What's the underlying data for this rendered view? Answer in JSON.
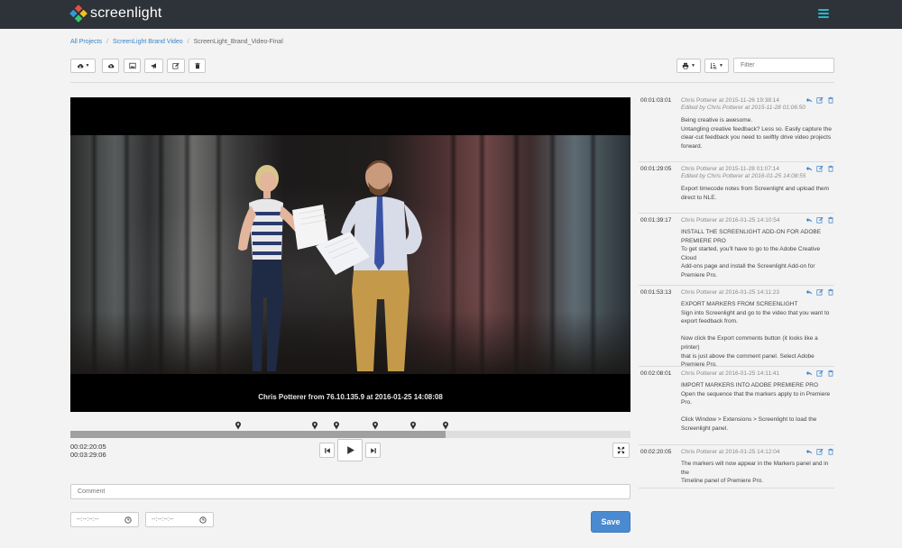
{
  "header": {
    "app_name": "screenlight",
    "logo_icon": "screenlight-logo-icon",
    "menu_icon": "hamburger-menu-icon",
    "accent_color": "#29b6c8"
  },
  "breadcrumb": {
    "items": [
      "All Projects",
      "ScreenLight Brand Video"
    ],
    "current": "ScreenLight_Brand_Video-Final"
  },
  "toolbar": {
    "left_icons": [
      "cloud-download-icon",
      "cloud-upload-icon",
      "image-icon",
      "megaphone-icon",
      "edit-icon",
      "trash-icon"
    ],
    "right_icons": [
      "print-icon",
      "sort-icon"
    ],
    "filter_placeholder": "Filter"
  },
  "player": {
    "caption": "Chris Potterer from 76.10.135.9 at 2016-01-25 14:08:08",
    "current_time": "00:02:20:05",
    "duration": "00:03:29:06",
    "progress": 0.67,
    "marker_positions": [
      0.3,
      0.437,
      0.475,
      0.545,
      0.612,
      0.67
    ],
    "controls": [
      "skip-back-icon",
      "play-icon",
      "skip-forward-icon",
      "fullscreen-icon"
    ]
  },
  "composer": {
    "comment_placeholder": "Comment",
    "in_placeholder": "--:--:--:--",
    "out_placeholder": "--:--:--:--",
    "save_label": "Save",
    "save_color": "#4a8ad1"
  },
  "comments": [
    {
      "tc": "00:01:03:01",
      "author": "Chris Potterer at 2015-11-26 19:38:14",
      "edited": "Edited by Chris Potterer at 2015-11-28 01:06:50",
      "lines": [
        "Being creative is awesome.",
        "Untangling creative feedback? Less so. Easily capture the",
        "clear-cut feedback you need to swiftly drive video projects",
        "forward."
      ]
    },
    {
      "tc": "00:01:29:05",
      "author": "Chris Potterer at 2015-11-28 01:07:14",
      "edited": "Edited by Chris Potterer at 2016-01-25 14:08:55",
      "lines": [
        "Export timecode notes from Screenlight and upload them",
        "direct to NLE."
      ]
    },
    {
      "tc": "00:01:39:17",
      "author": "Chris Potterer at 2016-01-25 14:10:54",
      "edited": "",
      "lines": [
        "INSTALL THE SCREENLIGHT ADD-ON FOR ADOBE",
        "PREMIERE PRO",
        "To get started, you'll have to go to the Adobe Creative Cloud",
        "Add-ons page and install the Screenlight Add-on for",
        "Premiere Pro."
      ]
    },
    {
      "tc": "00:01:53:13",
      "author": "Chris Potterer at 2016-01-25 14:11:23",
      "edited": "",
      "lines": [
        "EXPORT MARKERS FROM SCREENLIGHT",
        "Sign into Screenlight and go to the video that you want to",
        "export feedback from.",
        "",
        "Now click the Export comments button (it looks like a printer)",
        "that is just above the comment panel. Select Adobe",
        "Premiere Pro."
      ]
    },
    {
      "tc": "00:02:08:01",
      "author": "Chris Potterer at 2016-01-25 14:11:41",
      "edited": "",
      "lines": [
        "IMPORT MARKERS INTO ADOBE PREMIERE PRO",
        "Open the sequence that the markers apply to in Premiere",
        "Pro.",
        "",
        "Click Window > Extensions > Screenlight to load the",
        "Screenlight panel."
      ]
    },
    {
      "tc": "00:02:20:05",
      "author": "Chris Potterer at 2016-01-25 14:12:04",
      "edited": "",
      "lines": [
        "The markers will now appear in the Markers panel and in the",
        "Timeline panel of Premiere Pro."
      ]
    }
  ],
  "comment_actions": [
    "reply-icon",
    "edit-icon",
    "trash-icon"
  ],
  "link_color": "#3a84c8"
}
